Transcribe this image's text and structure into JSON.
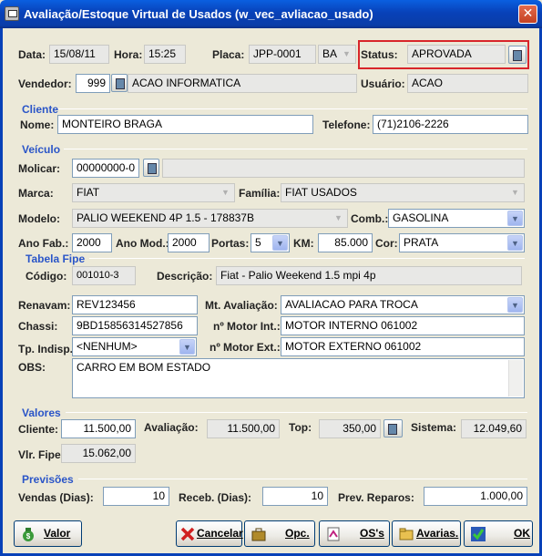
{
  "window": {
    "title": "Avaliação/Estoque Virtual de Usados (w_vec_avliacao_usado)",
    "close": "✕"
  },
  "header": {
    "data_label": "Data:",
    "data": "15/08/11",
    "hora_label": "Hora:",
    "hora": "15:25",
    "placa_label": "Placa:",
    "placa": "JPP-0001",
    "uf": "BA",
    "status_label": "Status:",
    "status": "APROVADA",
    "vendedor_label": "Vendedor:",
    "vendedor_code": "999",
    "vendedor_name": "ACAO INFORMATICA",
    "usuario_label": "Usuário:",
    "usuario": "ACAO"
  },
  "cliente": {
    "section": "Cliente",
    "nome_label": "Nome:",
    "nome": "MONTEIRO BRAGA",
    "telefone_label": "Telefone:",
    "telefone": "(71)2106-2226"
  },
  "veiculo": {
    "section": "Veículo",
    "molicar_label": "Molicar:",
    "molicar": "00000000-0",
    "molicar_desc": "",
    "marca_label": "Marca:",
    "marca": "FIAT",
    "familia_label": "Família:",
    "familia": "FIAT USADOS",
    "modelo_label": "Modelo:",
    "modelo": "PALIO WEEKEND 4P 1.5 - 178837B",
    "comb_label": "Comb.:",
    "comb": "GASOLINA",
    "anofab_label": "Ano Fab.:",
    "anofab": "2000",
    "anomod_label": "Ano Mod.:",
    "anomod": "2000",
    "portas_label": "Portas:",
    "portas": "5",
    "km_label": "KM:",
    "km": "85.000",
    "cor_label": "Cor:",
    "cor": "PRATA"
  },
  "fipe": {
    "section": "Tabela Fipe",
    "codigo_label": "Código:",
    "codigo": "001010-3",
    "descricao_label": "Descrição:",
    "descricao": "Fiat - Palio Weekend 1.5 mpi 4p"
  },
  "detalhes": {
    "renavam_label": "Renavam:",
    "renavam": "REV123456",
    "mtaval_label": "Mt. Avaliação:",
    "mtaval": "AVALIACAO PARA TROCA",
    "chassi_label": "Chassi:",
    "chassi": "9BD15856314527856",
    "motorint_label": "nº Motor Int.:",
    "motorint": "MOTOR INTERNO 061002",
    "tpindisp_label": "Tp. Indisp.:",
    "tpindisp": "<NENHUM>",
    "motorext_label": "nº Motor Ext.:",
    "motorext": "MOTOR EXTERNO 061002",
    "obs_label": "OBS:",
    "obs": "CARRO EM BOM ESTADO"
  },
  "valores": {
    "section": "Valores",
    "cliente_label": "Cliente:",
    "cliente": "11.500,00",
    "avaliacao_label": "Avaliação:",
    "avaliacao": "11.500,00",
    "top_label": "Top:",
    "top": "350,00",
    "sistema_label": "Sistema:",
    "sistema": "12.049,60",
    "fipe_label": "Vlr. Fipe:",
    "fipe": "15.062,00"
  },
  "previsoes": {
    "section": "Previsões",
    "vendas_label": "Vendas (Dias):",
    "vendas": "10",
    "receb_label": "Receb. (Dias):",
    "receb": "10",
    "reparos_label": "Prev. Reparos:",
    "reparos": "1.000,00"
  },
  "buttons": {
    "valor": "Valor",
    "cancelar": "Cancelar",
    "opc": "Opc.",
    "oss": "OS's",
    "avarias": "Avarias.",
    "ok": "OK"
  },
  "colors": {
    "accent": "#2a55c8",
    "status_border": "#d8252a",
    "titlebar": "#0841b8"
  }
}
